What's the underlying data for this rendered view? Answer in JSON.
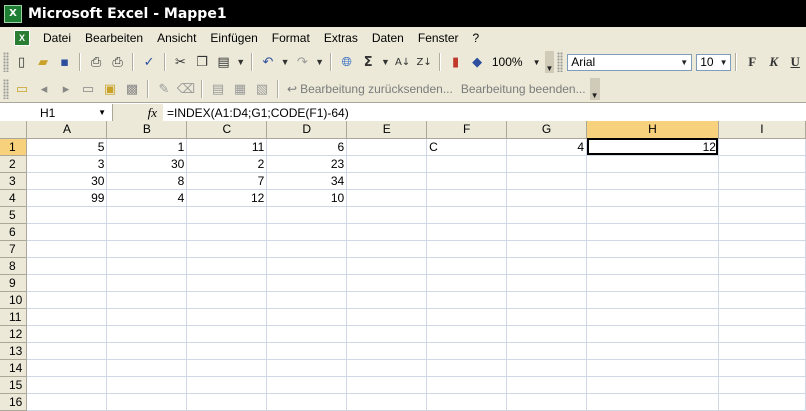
{
  "window": {
    "title": "Microsoft Excel - Mappe1",
    "app_icon_letter": "X"
  },
  "menu": [
    "Datei",
    "Bearbeiten",
    "Ansicht",
    "Einfügen",
    "Format",
    "Extras",
    "Daten",
    "Fenster",
    "?"
  ],
  "toolbar": {
    "zoom": "100%",
    "font_name": "Arial",
    "font_size": "10",
    "bold": "F",
    "italic": "K",
    "underline": "U",
    "review_send": "Bearbeitung zurücksenden...",
    "review_end": "Bearbeitung beenden...",
    "sum_glyph": "Σ"
  },
  "formula_bar": {
    "name_box": "H1",
    "fx": "fx",
    "formula": "=INDEX(A1:D4;G1;CODE(F1)-64)"
  },
  "sheet": {
    "columns": [
      "A",
      "B",
      "C",
      "D",
      "E",
      "F",
      "G",
      "H",
      "I"
    ],
    "rows": [
      [
        "5",
        "1",
        "11",
        "6",
        "",
        "C",
        "4",
        "12",
        ""
      ],
      [
        "3",
        "30",
        "2",
        "23",
        "",
        "",
        "",
        "",
        ""
      ],
      [
        "30",
        "8",
        "7",
        "34",
        "",
        "",
        "",
        "",
        ""
      ],
      [
        "99",
        "4",
        "12",
        "10",
        "",
        "",
        "",
        "",
        ""
      ],
      [
        "",
        "",
        "",
        "",
        "",
        "",
        "",
        "",
        ""
      ],
      [
        "",
        "",
        "",
        "",
        "",
        "",
        "",
        "",
        ""
      ],
      [
        "",
        "",
        "",
        "",
        "",
        "",
        "",
        "",
        ""
      ],
      [
        "",
        "",
        "",
        "",
        "",
        "",
        "",
        "",
        ""
      ],
      [
        "",
        "",
        "",
        "",
        "",
        "",
        "",
        "",
        ""
      ],
      [
        "",
        "",
        "",
        "",
        "",
        "",
        "",
        "",
        ""
      ],
      [
        "",
        "",
        "",
        "",
        "",
        "",
        "",
        "",
        ""
      ],
      [
        "",
        "",
        "",
        "",
        "",
        "",
        "",
        "",
        ""
      ],
      [
        "",
        "",
        "",
        "",
        "",
        "",
        "",
        "",
        ""
      ],
      [
        "",
        "",
        "",
        "",
        "",
        "",
        "",
        "",
        ""
      ],
      [
        "",
        "",
        "",
        "",
        "",
        "",
        "",
        "",
        ""
      ],
      [
        "",
        "",
        "",
        "",
        "",
        "",
        "",
        "",
        ""
      ]
    ],
    "row_numbers": [
      "1",
      "2",
      "3",
      "4",
      "5",
      "6",
      "7",
      "8",
      "9",
      "10",
      "11",
      "12",
      "13",
      "14",
      "15",
      "16"
    ],
    "active_cell": "H1",
    "text_cells": [
      "F1"
    ]
  },
  "colors": {
    "selected_header": "#f8d17d",
    "gridline": "#d0d7e5",
    "chrome": "#ece9d8"
  }
}
